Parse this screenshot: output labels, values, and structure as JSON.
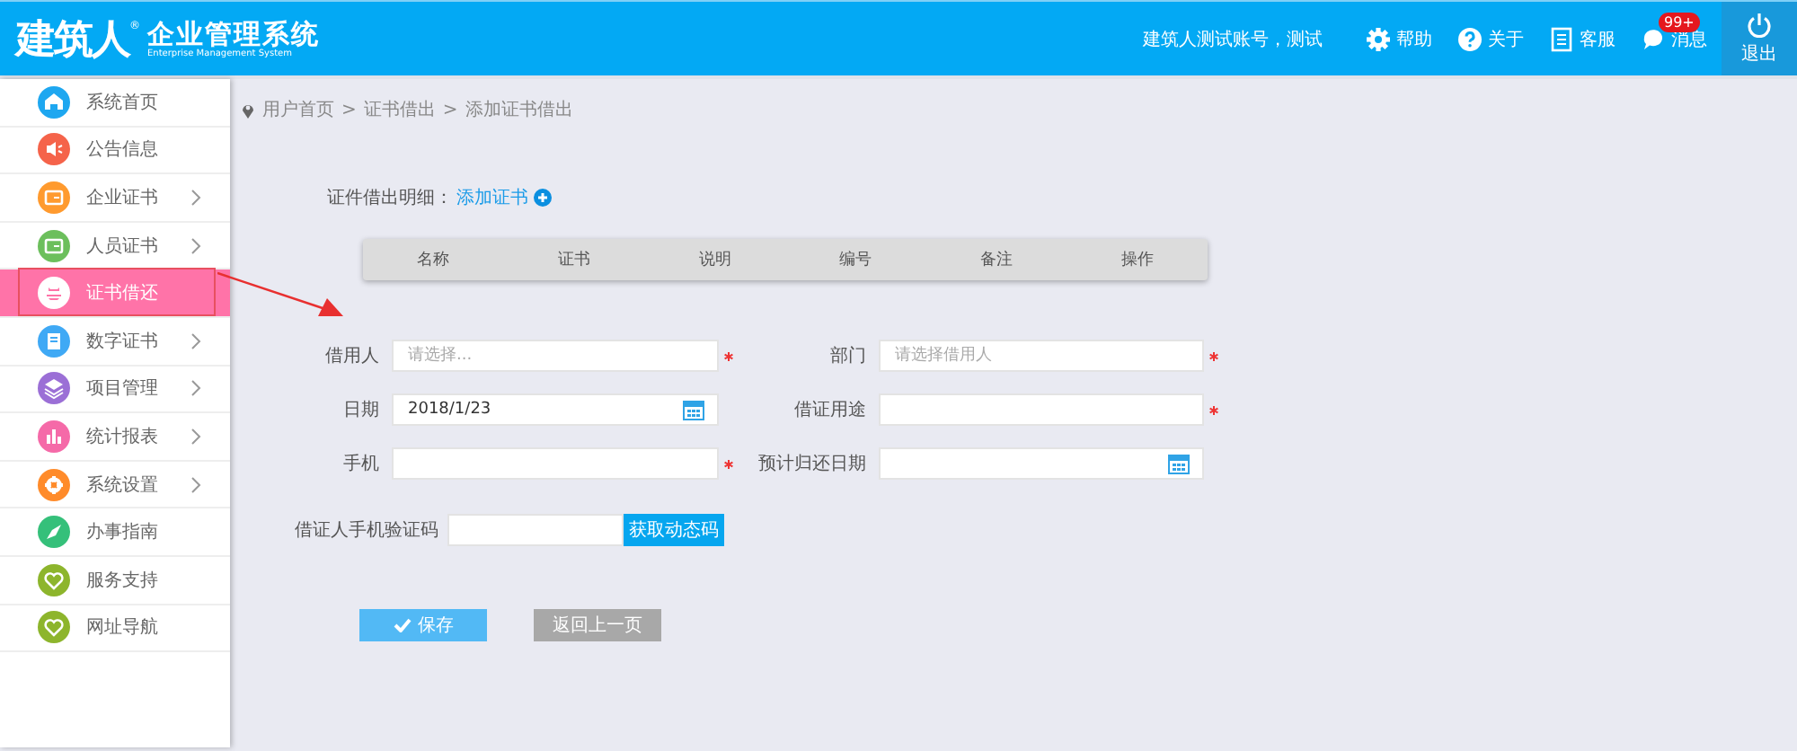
{
  "header": {
    "logo": {
      "brand": "建筑人",
      "mark": "®",
      "title": "企业管理系统",
      "subtitle": "Enterprise Management System"
    },
    "user": "建筑人测试账号，测试",
    "actions": [
      {
        "kind": "help",
        "label": "帮助"
      },
      {
        "kind": "about",
        "label": "关于"
      },
      {
        "kind": "service",
        "label": "客服"
      },
      {
        "kind": "messages",
        "label": "消息",
        "badge": "99+"
      }
    ],
    "logout": "退出"
  },
  "sidebar": {
    "items": [
      {
        "label": "系统首页",
        "color": "#1ea7f0",
        "submenu": false,
        "selected": false
      },
      {
        "label": "公告信息",
        "color": "#f5634a",
        "submenu": false,
        "selected": false
      },
      {
        "label": "企业证书",
        "color": "#ff9a2e",
        "submenu": true,
        "selected": false
      },
      {
        "label": "人员证书",
        "color": "#6cbf5c",
        "submenu": true,
        "selected": false
      },
      {
        "label": "证书借还",
        "color": "#ffffff",
        "submenu": false,
        "selected": true
      },
      {
        "label": "数字证书",
        "color": "#3fa9f5",
        "submenu": true,
        "selected": false
      },
      {
        "label": "项目管理",
        "color": "#9b6fd6",
        "submenu": true,
        "selected": false
      },
      {
        "label": "统计报表",
        "color": "#f56aa8",
        "submenu": true,
        "selected": false
      },
      {
        "label": "系统设置",
        "color": "#ff8b2a",
        "submenu": true,
        "selected": false
      },
      {
        "label": "办事指南",
        "color": "#35c07a",
        "submenu": false,
        "selected": false
      },
      {
        "label": "服务支持",
        "color": "#8db52c",
        "submenu": false,
        "selected": false
      },
      {
        "label": "网址导航",
        "color": "#8db52c",
        "submenu": false,
        "selected": false
      }
    ]
  },
  "breadcrumb": {
    "separator": ">",
    "items": [
      "用户首页",
      "证书借出",
      "添加证书借出"
    ]
  },
  "detail": {
    "label": "证件借出明细：",
    "link": "添加证书"
  },
  "table": {
    "columns": [
      "名称",
      "证书",
      "说明",
      "编号",
      "备注",
      "操作"
    ]
  },
  "form": {
    "fields": [
      {
        "label": "借用人",
        "kind": "text",
        "placeholder": "请选择...",
        "required": true
      },
      {
        "label": "部门",
        "kind": "text",
        "placeholder": "请选择借用人",
        "required": true
      },
      {
        "label": "日期",
        "kind": "date",
        "value": "2018/1/23",
        "required": false
      },
      {
        "label": "借证用途",
        "kind": "text",
        "required": true
      },
      {
        "label": "手机",
        "kind": "text",
        "required": true
      },
      {
        "label": "预计归还日期",
        "kind": "date",
        "required": false
      }
    ],
    "code": {
      "label": "借证人手机验证码",
      "button": "获取动态码"
    }
  },
  "buttons": [
    {
      "kind": "primary",
      "label": "保存"
    },
    {
      "kind": "secondary",
      "label": "返回上一页"
    }
  ]
}
